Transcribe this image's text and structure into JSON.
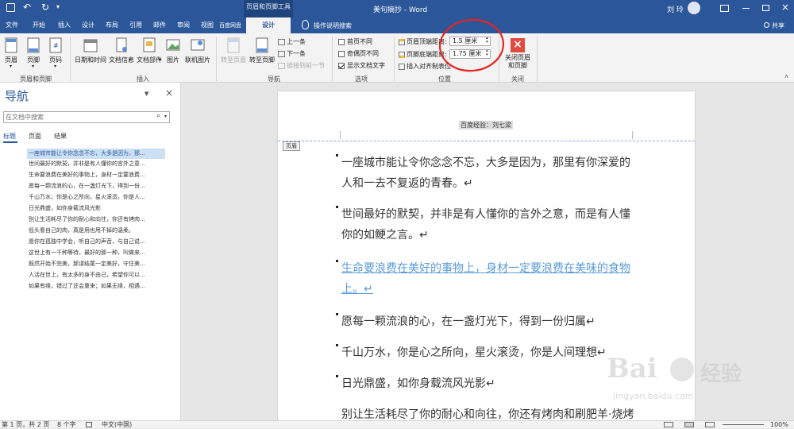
{
  "titlebar": {
    "context_header": "页眉和页脚工具",
    "title": "美句摘抄 - Word",
    "user": "刘 玲"
  },
  "tabs": [
    {
      "label": "文件"
    },
    {
      "label": "开始"
    },
    {
      "label": "插入"
    },
    {
      "label": "设计"
    },
    {
      "label": "布局"
    },
    {
      "label": "引用"
    },
    {
      "label": "邮件"
    },
    {
      "label": "审阅"
    },
    {
      "label": "视图"
    },
    {
      "label": "百度网盘"
    },
    {
      "label": "设计"
    }
  ],
  "tellme": "操作说明搜索",
  "share": "共享",
  "ribbon": {
    "groups": {
      "header_footer": "页眉和页脚",
      "insert": "插入",
      "navigation": "导航",
      "options": "选项",
      "position": "位置",
      "close": "关闭"
    },
    "header_btn": "页眉",
    "footer_btn": "页脚",
    "pagenum_btn": "页码",
    "datetime_btn": "日期和时间",
    "docinfo_btn": "文档信息",
    "docparts_btn": "文档部件",
    "picture_btn": "图片",
    "online_pic_btn": "联机图片",
    "goto_header": "转至页眉",
    "goto_footer": "转至页脚",
    "prev": "上一条",
    "next": "下一条",
    "link_prev": "链接到前一节",
    "first_page_diff": "首页不同",
    "odd_even_diff": "奇偶页不同",
    "show_doc_text": "显示文档文字",
    "header_top_label": "页眉顶端距离:",
    "header_top_value": "1.5 厘米",
    "footer_bottom_label": "页脚底端距离:",
    "footer_bottom_value": "1.75 厘米",
    "insert_align_tab": "插入对齐制表位",
    "close_btn": "关闭页眉和页脚"
  },
  "nav": {
    "title": "导航",
    "search_placeholder": "在文档中搜索",
    "tabs": [
      "标题",
      "页面",
      "结果"
    ],
    "items": [
      "一座城市能让令你念念不忘，大多是因为，那...",
      "世间最好的默契，并非是有人懂你的言外之意...",
      "生命要浪费在美好的事物上，身材一定要浪费...",
      "愿每一颗流浪的心，在一盏灯光下，得到一份...",
      "千山万水，你是心之所向，星火滚烫，你是人...",
      "日光鼎盛，如你身载流风光影",
      "别让生活耗尽了你的耐心和向往，你还有烤肉...",
      "低头看自己的肉，真是用也甩不掉的温柔。",
      "愿你在孤独中学会，听自己的声音，与自己说...",
      "这世上有一千种等待，最好的那一种，叫做来...",
      "既然开始不完美，那请结尾一定美好，守住美...",
      "人活在世上，有太多的身不由己，希望你可以...",
      "如果有缘，错过了还会重来；如果无缘，相遇..."
    ]
  },
  "doc": {
    "header_text": "百度经验：刘七梁",
    "header_tag": "页眉",
    "paragraphs": [
      "一座城市能让令你念念不忘，大多是因为，那里有你深爱的人和一去不复返的青春。↵",
      "世间最好的默契，并非是有人懂你的言外之意，而是有人懂你的如鲠之言。↵",
      "生命要浪费在美好的事物上，身材一定要浪费在美味的食物上。↵",
      "愿每一颗流浪的心，在一盏灯光下，得到一份归属↵",
      "千山万水，你是心之所向，星火滚烫，你是人间理想↵",
      "日光鼎盛，如你身载流风光影↵",
      "别让生活耗尽了你的耐心和向往，你还有烤肉和刷肥羊·烧烤"
    ]
  },
  "status": {
    "page": "第 1 页，共 2 页",
    "words": "8 个字",
    "lang": "中文(中国)",
    "zoom": "100%"
  },
  "watermark": {
    "brand": "Bai",
    "cn": "经验",
    "url": "jingyan.baidu.com"
  },
  "colors": {
    "word_blue": "#2b579a",
    "link_text": "#5b9bd5",
    "close_red": "#e04a3f",
    "annotation_red": "#e8231f"
  }
}
